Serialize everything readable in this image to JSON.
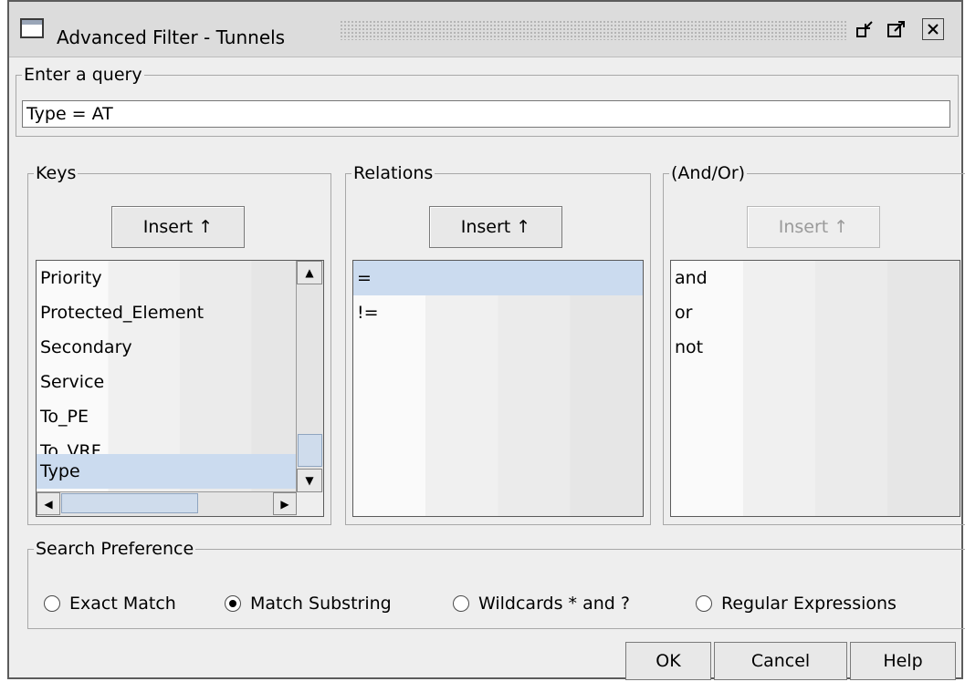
{
  "window": {
    "title": "Advanced Filter - Tunnels",
    "icons": [
      "window-icon",
      "undock-icon",
      "maximize-icon",
      "close-icon"
    ]
  },
  "query": {
    "legend": "Enter a query",
    "value": "Type = AT"
  },
  "keys": {
    "legend": "Keys",
    "insert_label": "Insert ↑",
    "items": [
      "Priority",
      "Protected_Element",
      "Secondary",
      "Service",
      "To_PE",
      "To_VRF",
      "Type"
    ],
    "selected": "Type"
  },
  "relations": {
    "legend": "Relations",
    "insert_label": "Insert ↑",
    "items": [
      "=",
      "!="
    ],
    "selected": "="
  },
  "andor": {
    "legend": "(And/Or)",
    "insert_label": "Insert ↑",
    "insert_enabled": false,
    "items": [
      "and",
      "or",
      "not"
    ]
  },
  "search_preference": {
    "legend": "Search Preference",
    "options": [
      "Exact Match",
      "Match Substring",
      "Wildcards * and ?",
      "Regular Expressions"
    ],
    "selected": "Match Substring"
  },
  "buttons": {
    "ok": "OK",
    "cancel": "Cancel",
    "help": "Help"
  },
  "colors": {
    "selection": "#cbdbef",
    "window_bg": "#eeeeee"
  }
}
